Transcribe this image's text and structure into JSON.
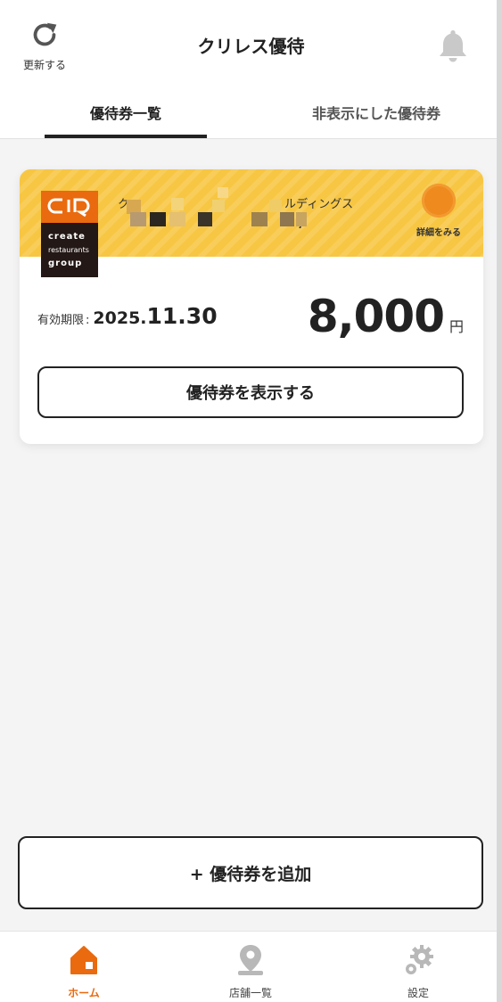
{
  "header": {
    "refresh_label": "更新する",
    "title": "クリレス優待",
    "refresh_icon": "refresh-icon",
    "bell_icon": "bell-icon"
  },
  "tabs": [
    {
      "label": "優待券一覧",
      "active": true
    },
    {
      "label": "非表示にした優待券",
      "active": false
    }
  ],
  "coupon": {
    "logo": {
      "line1": "create",
      "line2": "restaurants",
      "line3": "group",
      "color": "#ea6a0f"
    },
    "company_name_visible_start": "ク",
    "company_name_visible_end": "ルディングス",
    "company_code_visible_end": "7",
    "detail_label": "詳細をみる",
    "expiry_label": "有効期限",
    "expiry_separator": ":",
    "expiry_year": "2025.",
    "expiry_month_day": "11.30",
    "amount": "8,000",
    "amount_unit": "円",
    "show_button_label": "優待券を表示する",
    "accent_color": "#f7c643"
  },
  "add_button_label": "+ 優待券を追加",
  "bottom_nav": [
    {
      "label": "ホーム",
      "icon": "home-icon",
      "active": true
    },
    {
      "label": "店舗一覧",
      "icon": "map-pin-icon",
      "active": false
    },
    {
      "label": "設定",
      "icon": "gear-icon",
      "active": false
    }
  ],
  "colors": {
    "brand_orange": "#ea6a0f",
    "card_yellow": "#f7c643",
    "background": "#f4f4f4"
  }
}
